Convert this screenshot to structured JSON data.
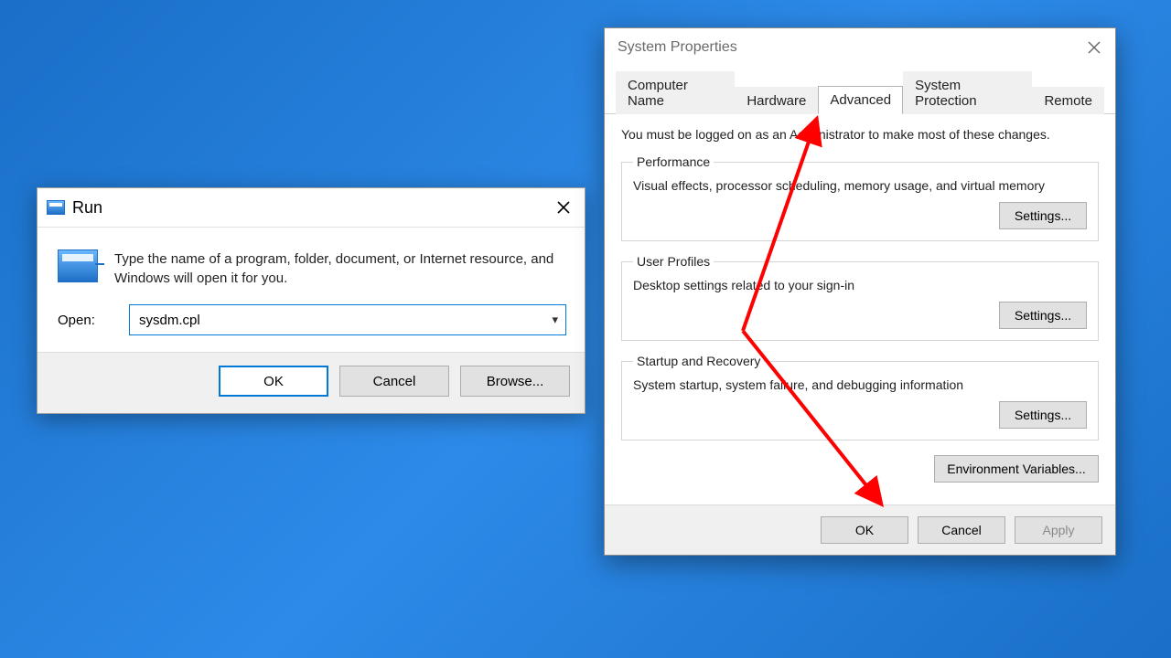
{
  "run": {
    "title": "Run",
    "description": "Type the name of a program, folder, document, or Internet resource, and Windows will open it for you.",
    "open_label": "Open:",
    "command": "sysdm.cpl",
    "buttons": {
      "ok": "OK",
      "cancel": "Cancel",
      "browse": "Browse..."
    }
  },
  "sys": {
    "title": "System Properties",
    "tabs": [
      "Computer Name",
      "Hardware",
      "Advanced",
      "System Protection",
      "Remote"
    ],
    "active_tab_index": 2,
    "note": "You must be logged on as an Administrator to make most of these changes.",
    "groups": {
      "performance": {
        "legend": "Performance",
        "desc": "Visual effects, processor scheduling, memory usage, and virtual memory",
        "button": "Settings..."
      },
      "user_profiles": {
        "legend": "User Profiles",
        "desc": "Desktop settings related to your sign-in",
        "button": "Settings..."
      },
      "startup": {
        "legend": "Startup and Recovery",
        "desc": "System startup, system failure, and debugging information",
        "button": "Settings..."
      }
    },
    "env_button": "Environment Variables...",
    "footer": {
      "ok": "OK",
      "cancel": "Cancel",
      "apply": "Apply"
    }
  }
}
